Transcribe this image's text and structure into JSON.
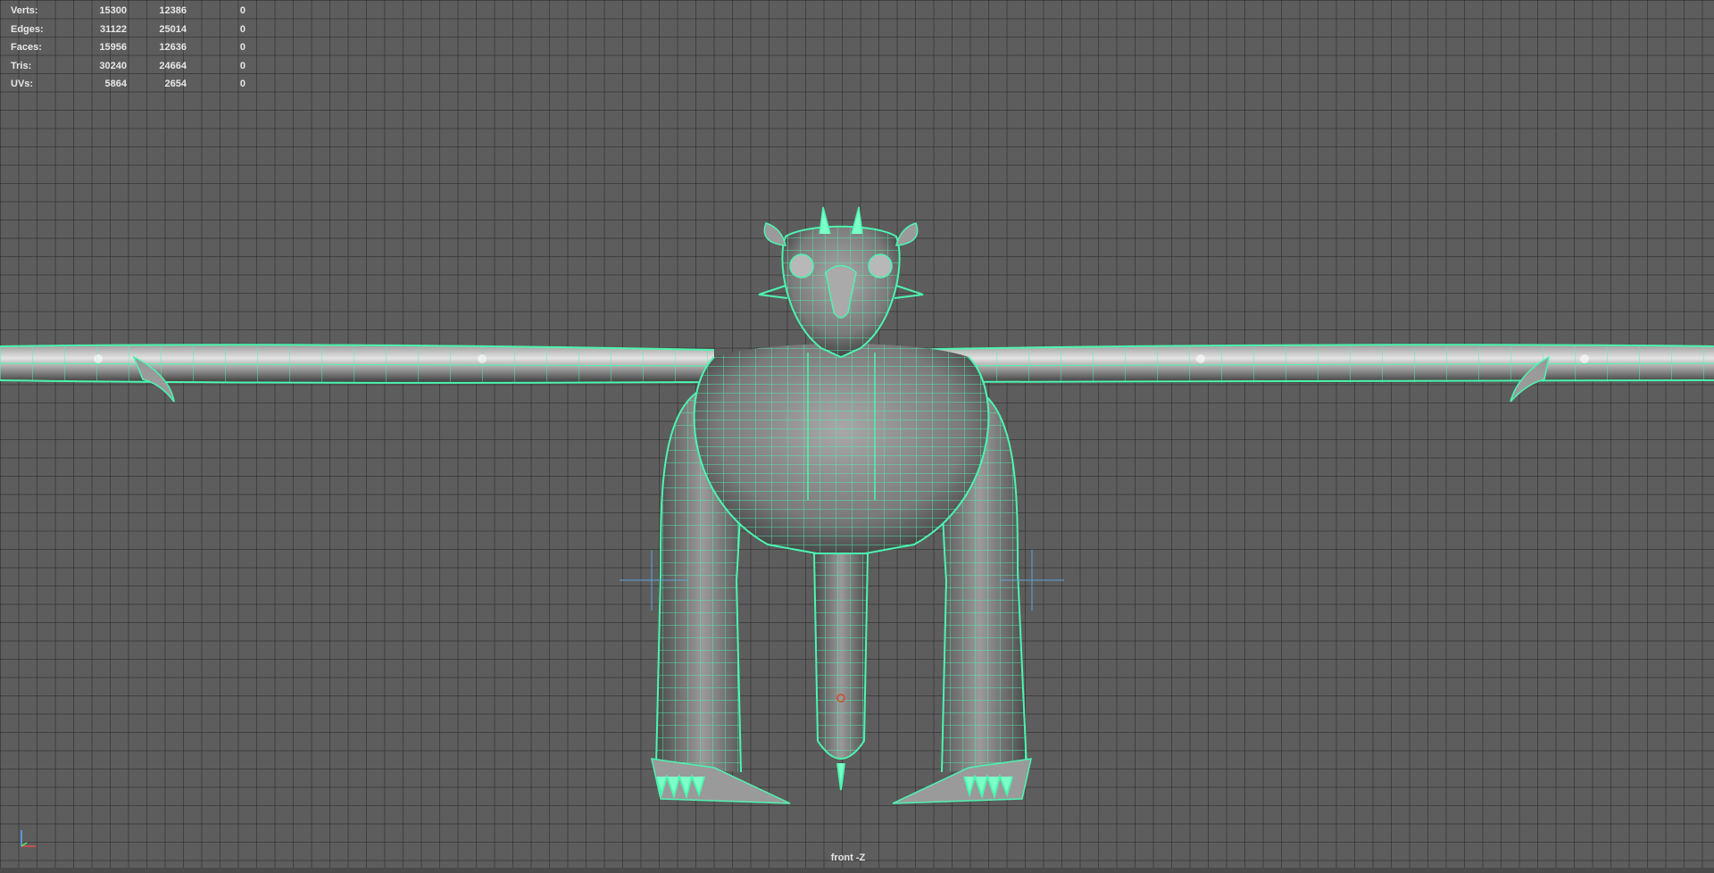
{
  "hud": {
    "rows": [
      {
        "label": "Verts:",
        "v1": "15300",
        "v2": "12386",
        "v3": "0"
      },
      {
        "label": "Edges:",
        "v1": "31122",
        "v2": "25014",
        "v3": "0"
      },
      {
        "label": "Faces:",
        "v1": "15956",
        "v2": "12636",
        "v3": "0"
      },
      {
        "label": "Tris:",
        "v1": "30240",
        "v2": "24664",
        "v3": "0"
      },
      {
        "label": "UVs:",
        "v1": "5864",
        "v2": "2654",
        "v3": "0"
      }
    ]
  },
  "viewport": {
    "camera_label": "front -Z",
    "wireframe_color": "#4cf5b0",
    "grid_color": "#3a3a3a",
    "background_color": "#5d5d5d"
  },
  "axis_gizmo": {
    "icon": "axis-gizmo-icon"
  }
}
